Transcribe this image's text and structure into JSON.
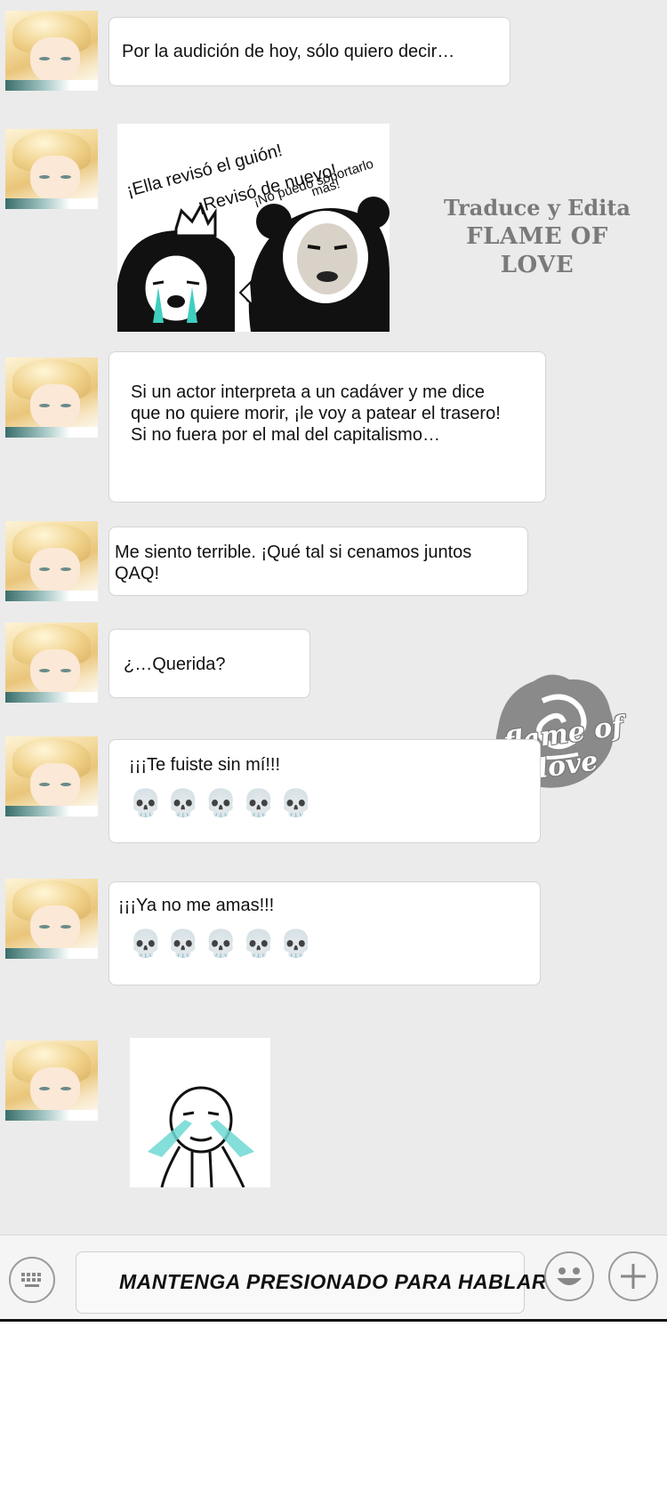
{
  "messages": [
    {
      "kind": "text",
      "text": "Por la audición de hoy, sólo quiero decir…"
    },
    {
      "kind": "sticker",
      "captions": [
        "¡Ella revisó el guión!",
        "¡Revisó de nuevo!",
        "¡No puedo soportarlo",
        "más!"
      ]
    },
    {
      "kind": "text",
      "text": "Si un actor interpreta a un cadáver  y me dice\nque no quiere morir, ¡le voy a patear el trasero!\nSi no fuera por el mal del capitalismo…"
    },
    {
      "kind": "text",
      "text": "Me siento terrible. ¡Qué tal si cenamos juntos\nQAQ!"
    },
    {
      "kind": "text",
      "text": "¿…Querida?"
    },
    {
      "kind": "text",
      "text": "¡¡¡Te fuiste sin mí!!!",
      "emoji": "💀💀💀💀💀"
    },
    {
      "kind": "text",
      "text": "¡¡¡Ya no me amas!!!",
      "emoji": "💀💀💀💀💀"
    },
    {
      "kind": "sticker",
      "captions": []
    }
  ],
  "watermark": {
    "line1": "Traduce y Edita",
    "line2": "FLAME OF LOVE",
    "logo_text": "flame of love"
  },
  "input_bar": {
    "hold_to_talk_label": "MANTENGA PRESIONADO PARA HABLAR",
    "keyboard_icon": "keyboard-icon",
    "emoji_icon": "smiley-icon",
    "plus_icon": "plus-icon"
  },
  "colors": {
    "chat_background": "#ebebeb",
    "bubble": "#ffffff",
    "tears": "#4fd6c8"
  }
}
